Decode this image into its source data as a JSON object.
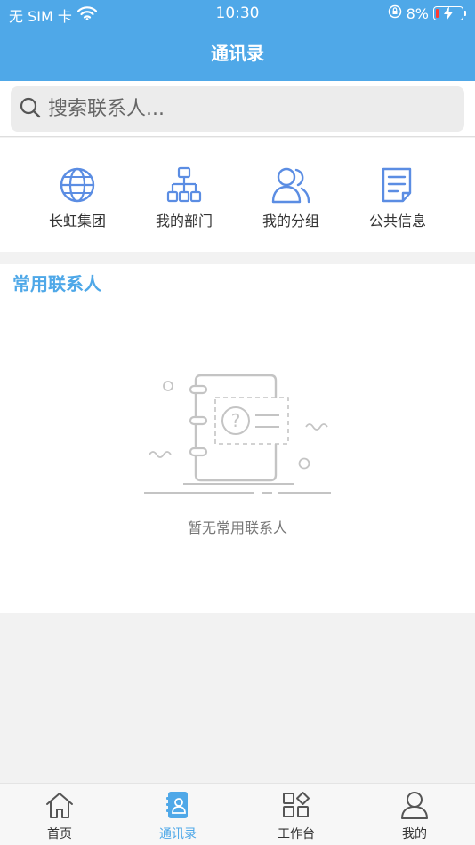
{
  "status_bar": {
    "carrier": "无 SIM 卡",
    "time": "10:30",
    "battery": "8%",
    "battery_level_percent": 8
  },
  "header": {
    "title": "通讯录"
  },
  "search": {
    "placeholder": "搜索联系人..."
  },
  "shortcuts": [
    {
      "label": "长虹集团",
      "icon": "globe-icon"
    },
    {
      "label": "我的部门",
      "icon": "org-chart-icon"
    },
    {
      "label": "我的分组",
      "icon": "group-icon"
    },
    {
      "label": "公共信息",
      "icon": "document-icon"
    }
  ],
  "frequent": {
    "title": "常用联系人",
    "empty_text": "暂无常用联系人"
  },
  "tabbar": [
    {
      "label": "首页",
      "icon": "home-icon",
      "active": false
    },
    {
      "label": "通讯录",
      "icon": "contacts-icon",
      "active": true
    },
    {
      "label": "工作台",
      "icon": "workbench-icon",
      "active": false
    },
    {
      "label": "我的",
      "icon": "user-icon",
      "active": false
    }
  ],
  "colors": {
    "accent": "#4fa8e8",
    "icon_blue": "#5b8de3",
    "background": "#f2f2f2"
  }
}
